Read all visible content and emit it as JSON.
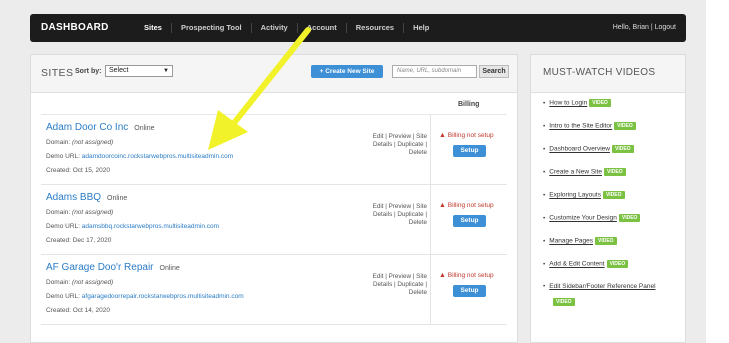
{
  "topbar": {
    "brand": "DASHBOARD",
    "nav": [
      "Sites",
      "Prospecting Tool",
      "Activity",
      "Account",
      "Resources",
      "Help"
    ],
    "user": "Hello, Brian | Logout"
  },
  "sites": {
    "title": "SITES",
    "sort_label": "Sort by:",
    "sort_value": "Select",
    "create_label": "+ Create New Site",
    "search_placeholder": "Name, URL, subdomain",
    "search_label": "Search",
    "billing_header": "Billing",
    "rows": [
      {
        "name": "Adam Door Co Inc",
        "status": "Online",
        "domain_label": "Domain:",
        "domain_value": "(not assigned)",
        "demo_label": "Demo URL:",
        "demo_url": "adamdoorcoinc.rockstarwebpros.multisiteadmin.com",
        "created": "Created: Oct 15, 2020",
        "actions": "Edit | Preview | Site Details | Duplicate | Delete",
        "billing": "Billing not setup",
        "setup": "Setup"
      },
      {
        "name": "Adams BBQ",
        "status": "Online",
        "domain_label": "Domain:",
        "domain_value": "(not assigned)",
        "demo_label": "Demo URL:",
        "demo_url": "adamsbbq.rockstarwebpros.multisiteadmin.com",
        "created": "Created: Dec 17, 2020",
        "actions": "Edit | Preview | Site Details | Duplicate | Delete",
        "billing": "Billing not setup",
        "setup": "Setup"
      },
      {
        "name": "AF Garage Doo'r Repair",
        "status": "Online",
        "domain_label": "Domain:",
        "domain_value": "(not assigned)",
        "demo_label": "Demo URL:",
        "demo_url": "afgaragedoorrepair.rockstarwebpros.multisiteadmin.com",
        "created": "Created: Oct 14, 2020",
        "actions": "Edit | Preview | Site Details | Duplicate | Delete",
        "billing": "Billing not setup",
        "setup": "Setup"
      }
    ]
  },
  "videos": {
    "title": "MUST-WATCH VIDEOS",
    "badge": "VIDEO",
    "items": [
      "How to Login",
      "Intro to the Site Editor",
      "Dashboard Overview",
      "Create a New Site",
      "Exploring Layouts",
      "Customize Your Design",
      "Manage Pages",
      "Add & Edit Content",
      "Edit Sidebar/Footer Reference Panel"
    ]
  },
  "colors": {
    "topbar": "#1c1c1c",
    "accent_blue": "#3d8fd6",
    "video_badge": "#7cc242",
    "warning_red": "#c0392b",
    "arrow_yellow": "#f2f22a"
  }
}
